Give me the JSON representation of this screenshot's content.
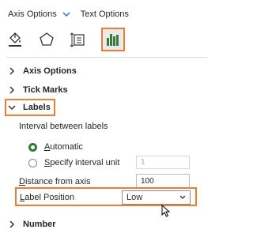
{
  "header": {
    "tab_axis_options": "Axis Options",
    "tab_text_options": "Text Options"
  },
  "icons": [
    "fill-line-icon",
    "effects-pentagon-icon",
    "size-properties-icon",
    "axis-options-bar-chart-icon"
  ],
  "colors": {
    "accent_orange": "#ed7d31",
    "radio_green": "#2e7d32",
    "icon_green": "#3a7a3a"
  },
  "sections": {
    "axis_options": "Axis Options",
    "tick_marks": "Tick Marks",
    "labels": "Labels",
    "number": "Number"
  },
  "labels_panel": {
    "interval_heading": "Interval between labels",
    "automatic_u": "A",
    "automatic_rest": "utomatic",
    "specify_u": "S",
    "specify_rest": "pecify interval unit",
    "interval_value": "1",
    "distance_u": "D",
    "distance_rest": "istance from axis",
    "distance_value": "100",
    "label_position_u": "L",
    "label_position_rest": "abel Position",
    "label_position_value": "Low"
  }
}
